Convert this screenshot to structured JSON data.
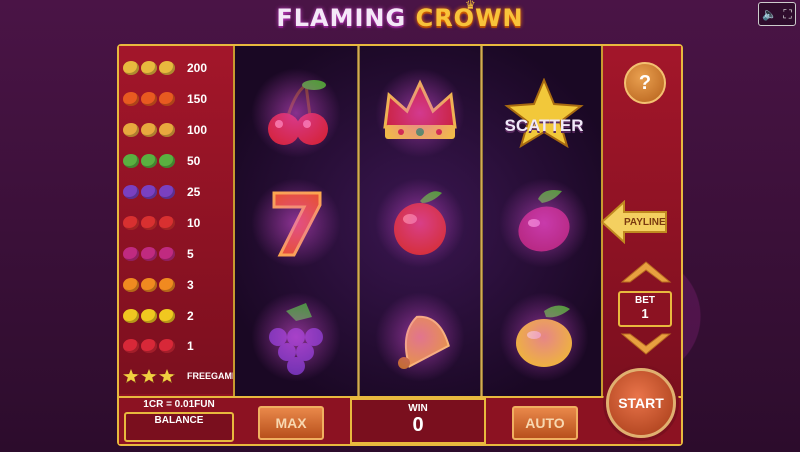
{
  "title": {
    "word1": "FLAMING",
    "word2": "CROWN"
  },
  "paytable": [
    {
      "symbol": "crown-icon",
      "value": "200",
      "color": "#e8b93e"
    },
    {
      "symbol": "seven-icon",
      "value": "150",
      "color": "#e85a20"
    },
    {
      "symbol": "bell-icon",
      "value": "100",
      "color": "#e8a83e"
    },
    {
      "symbol": "watermelon-icon",
      "value": "50",
      "color": "#5ab040"
    },
    {
      "symbol": "grapes-icon",
      "value": "25",
      "color": "#7a40c0"
    },
    {
      "symbol": "apple-icon",
      "value": "10",
      "color": "#d83030"
    },
    {
      "symbol": "plum-icon",
      "value": "5",
      "color": "#c02a80"
    },
    {
      "symbol": "orange-icon",
      "value": "3",
      "color": "#f08a20"
    },
    {
      "symbol": "lemon-icon",
      "value": "2",
      "color": "#f0c820"
    },
    {
      "symbol": "cherry-icon",
      "value": "1",
      "color": "#d82838"
    },
    {
      "symbol": "star-icon",
      "value": "FREEGAMES",
      "color": "#f0d040"
    }
  ],
  "reels": [
    [
      "cherry-icon",
      "seven-icon",
      "grapes-icon"
    ],
    [
      "crown-icon",
      "apple-icon",
      "bell-icon"
    ],
    [
      "scatter-icon",
      "plum-icon",
      "lemon-icon"
    ]
  ],
  "scatter_label": "SCATTER",
  "help_label": "?",
  "payline_label": "PAYLINE",
  "bet": {
    "label": "BET",
    "value": "1"
  },
  "conversion": "1CR = 0.01FUN",
  "balance": {
    "label": "BALANCE",
    "value": ""
  },
  "max_label": "MAX",
  "win": {
    "label": "WIN",
    "value": "0"
  },
  "auto_label": "AUTO",
  "start_label": "START",
  "sys": {
    "sound": "🔈",
    "fullscreen": "⛶"
  }
}
